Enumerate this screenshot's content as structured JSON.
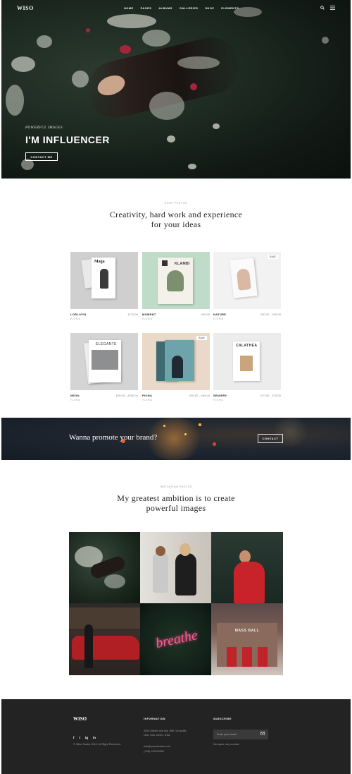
{
  "nav": {
    "logo": "WISO",
    "menu": [
      "HOME",
      "PAGES",
      "ALBUMS",
      "GALLERIES",
      "SHOP",
      "ELEMENTS"
    ]
  },
  "hero": {
    "subtitle": "POWERFUL IMAGES",
    "title": "I'M INFLUENCER",
    "button": "CONTACT ME"
  },
  "shop": {
    "kicker": "SHOP PHOTOS",
    "heading_line1": "Creativity, hard work and experience",
    "heading_line2": "for your ideas",
    "products": [
      {
        "name": "LORLIVYN",
        "price": "£175.00",
        "category": "FLORIA",
        "sale": ""
      },
      {
        "name": "MOMENT",
        "price": "£50.00",
        "category": "FLORIA",
        "sale": ""
      },
      {
        "name": "NATURE",
        "price": "£50.00 – £58.00",
        "category": "FLORIA",
        "sale": "SALE"
      },
      {
        "name": "NEON",
        "price": "£99.00 – £255.00",
        "category": "FLORIA",
        "sale": ""
      },
      {
        "name": "PIONA",
        "price": "£55.00 – £59.00",
        "category": "FLORIA",
        "sale": "SALE"
      },
      {
        "name": "SENIERY",
        "price": "£70.00 – £75.00",
        "category": "FLORIA",
        "sale": ""
      }
    ],
    "cover_texts": {
      "maga": "Maga",
      "klambi": "KLAMBI",
      "elegante": "ELEGANTE",
      "calathea": "CALATHEA"
    }
  },
  "promo": {
    "text": "Wanna promote your brand?",
    "button": "CONTACT"
  },
  "gallery": {
    "kicker": "INSTAGRAM PHOTOS",
    "heading_line1": "My greatest ambition is to create",
    "heading_line2": "powerful images",
    "neon_word": "breathe",
    "sign_word": "MASS BALL"
  },
  "footer": {
    "logo": "WISO",
    "social": [
      "f",
      "t",
      "ig",
      "in"
    ],
    "copyright": "© Wiso Studio 2018. All Right Reserved.",
    "info_heading": "INFORMATION",
    "address_line1": "2005 Stokes Isle Apt. 896, Venaville,",
    "address_line2": "New York 10010, USA",
    "email": "info@yourdomain.com",
    "phone": "(+68) 120034509",
    "subscribe_heading": "SUBSCRIBE",
    "email_placeholder": "Enter your email",
    "spam_note": "No spam, we promise"
  },
  "colors": {
    "footer_bg": "#232323",
    "hero_bg": "#1d2a22",
    "promo_bg": "#1b2430"
  }
}
